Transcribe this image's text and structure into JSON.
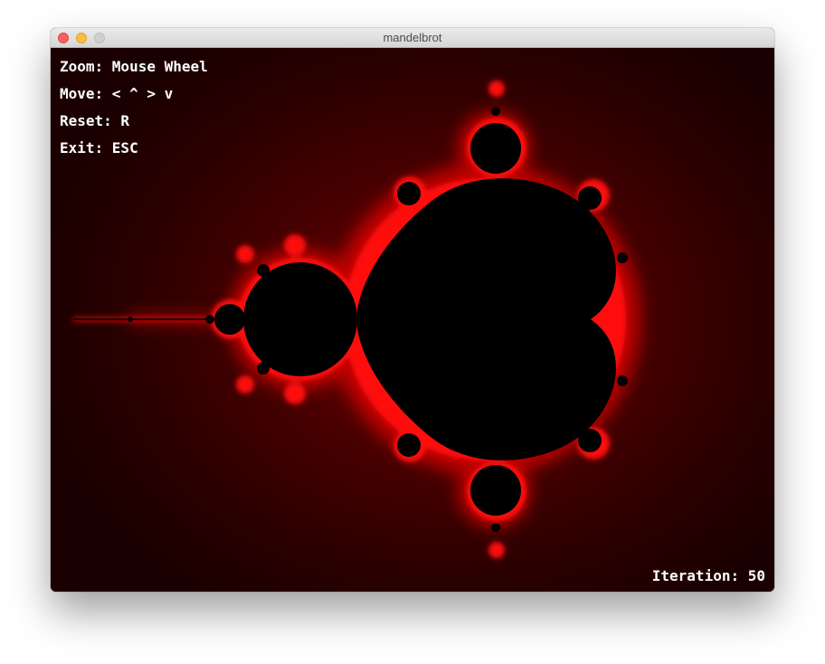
{
  "window": {
    "title": "mandelbrot"
  },
  "controls": {
    "zoom": "Zoom: Mouse Wheel",
    "move": "Move: < ^ > v",
    "reset": "Reset: R",
    "exit": "Exit: ESC"
  },
  "status": {
    "iteration_label": "Iteration:",
    "iteration_value": "50"
  },
  "colors": {
    "set": "#000000",
    "edge": "#ff1a1a",
    "background": "#2a0000"
  }
}
